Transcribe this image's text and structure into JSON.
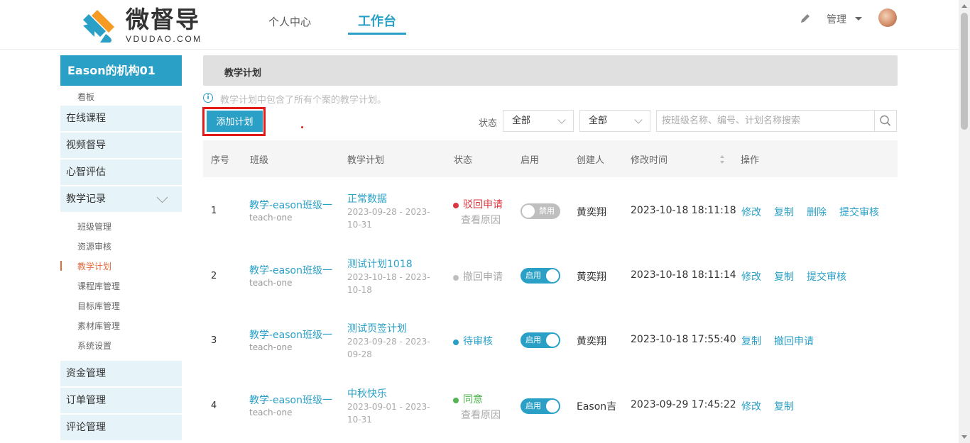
{
  "header": {
    "logo_text": "微督导",
    "logo_sub": "VDUDAO.COM",
    "tabs": [
      {
        "label": "个人中心"
      },
      {
        "label": "工作台"
      }
    ],
    "admin_label": "管理",
    "accent_color": "#2aa0c6"
  },
  "sidebar": {
    "org_title": "Eason的机构01",
    "board_label": "看板",
    "items": [
      {
        "label": "在线课程"
      },
      {
        "label": "视频督导"
      },
      {
        "label": "心智评估"
      },
      {
        "label": "教学记录"
      }
    ],
    "sub_items": [
      {
        "label": "班级管理"
      },
      {
        "label": "资源审核"
      },
      {
        "label": "教学计划"
      },
      {
        "label": "课程库管理"
      },
      {
        "label": "目标库管理"
      },
      {
        "label": "素材库管理"
      },
      {
        "label": "系统设置"
      }
    ],
    "bottom_items": [
      {
        "label": "资金管理"
      },
      {
        "label": "订单管理"
      },
      {
        "label": "评论管理"
      }
    ]
  },
  "main": {
    "breadcrumb": "教学计划",
    "info_text": "教学计划中包含了所有个案的教学计划。",
    "add_button": "添加计划",
    "filter_label": "状态",
    "select1": "全部",
    "select2": "全部",
    "search_placeholder": "按班级名称、编号、计划名称搜索",
    "columns": [
      "序号",
      "班级",
      "教学计划",
      "状态",
      "启用",
      "创建人",
      "修改时间",
      "操作"
    ],
    "rows": [
      {
        "index": "1",
        "class_name": "教学-eason班级一",
        "class_code": "teach-one",
        "plan_name": "正常数据",
        "plan_date": "2023-09-28 - 2023-10-31",
        "status": "驳回申请",
        "status_color": "#d9363e",
        "status_text_color": "#d9363e",
        "reason": "查看原因",
        "toggle": "禁用",
        "creator": "黄奕翔",
        "modified": "2023-10-18 18:11:18",
        "ops": [
          "修改",
          "复制",
          "删除",
          "提交审核"
        ]
      },
      {
        "index": "2",
        "class_name": "教学-eason班级一",
        "class_code": "teach-one",
        "plan_name": "测试计划1018",
        "plan_date": "2023-10-18 - 2023-10-18",
        "status": "撤回申请",
        "status_color": "#bfbfbf",
        "status_text_color": "#aaaaaa",
        "reason": "",
        "toggle": "启用",
        "creator": "黄奕翔",
        "modified": "2023-10-18 18:11:14",
        "ops": [
          "修改",
          "复制",
          "提交审核"
        ]
      },
      {
        "index": "3",
        "class_name": "教学-eason班级一",
        "class_code": "teach-one",
        "plan_name": "测试页签计划",
        "plan_date": "2023-09-28 - 2023-09-28",
        "status": "待审核",
        "status_color": "#2aa0c6",
        "status_text_color": "#2aa0c6",
        "reason": "",
        "toggle": "启用",
        "creator": "黄奕翔",
        "modified": "2023-10-18 17:55:40",
        "ops": [
          "复制",
          "撤回申请"
        ]
      },
      {
        "index": "4",
        "class_name": "教学-eason班级一",
        "class_code": "teach-one",
        "plan_name": "中秋快乐",
        "plan_date": "2023-09-01 - 2023-10-31",
        "status": "同意",
        "status_color": "#52b452",
        "status_text_color": "#52b452",
        "reason": "查看原因",
        "toggle": "启用",
        "creator": "Eason吉",
        "modified": "2023-09-29 17:45:22",
        "ops": [
          "修改",
          "复制"
        ]
      }
    ]
  }
}
